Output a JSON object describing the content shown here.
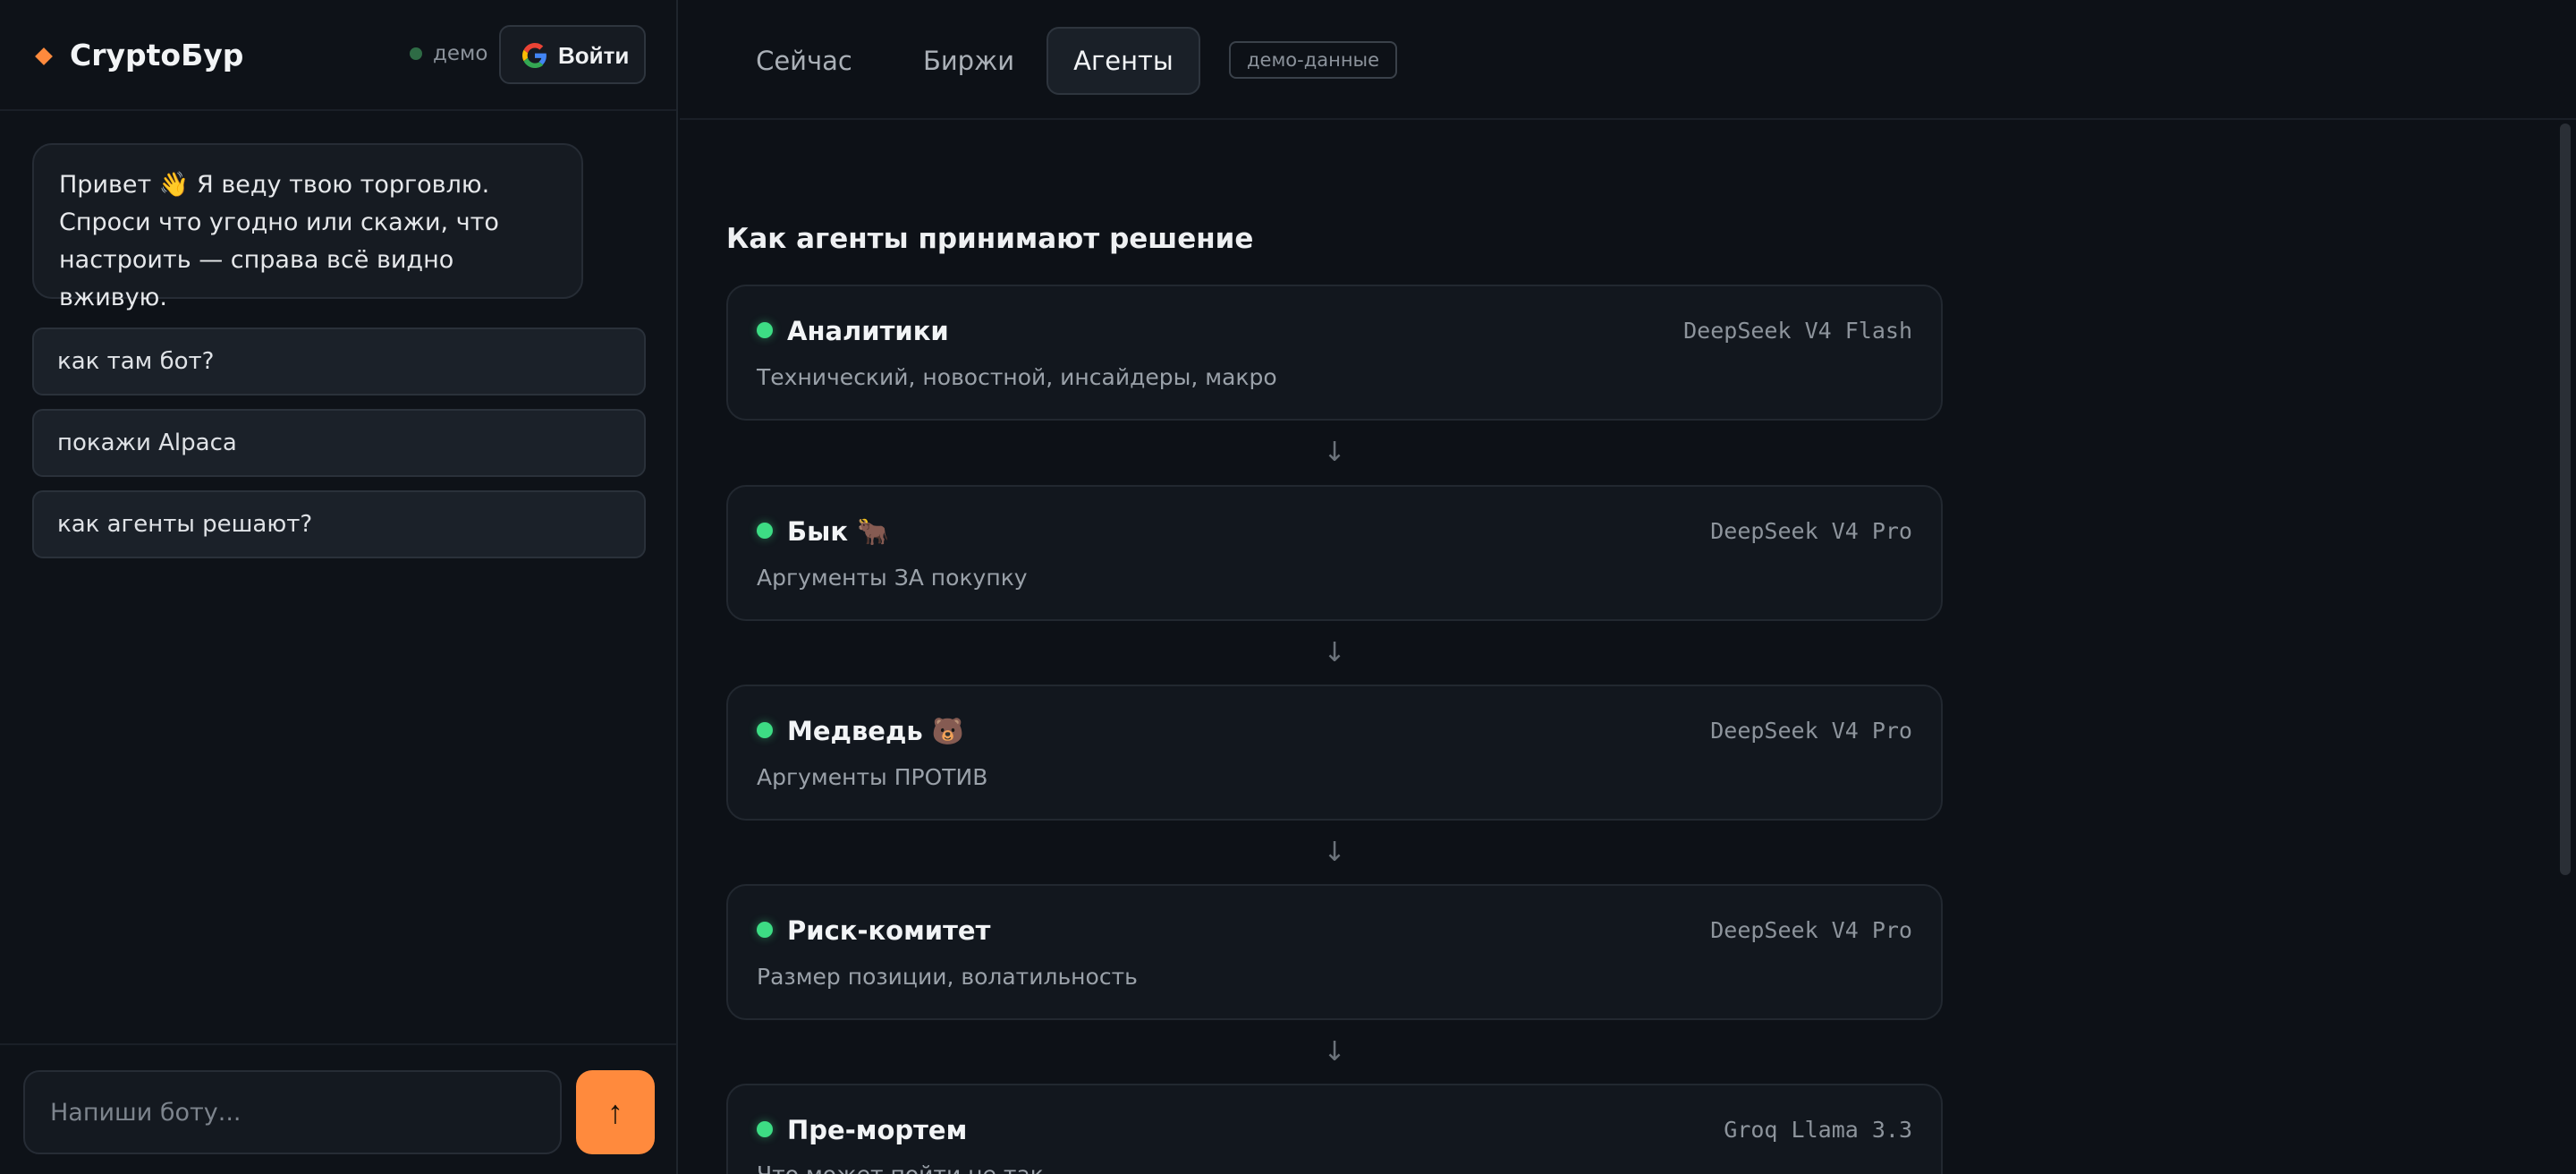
{
  "app": {
    "brand": "CryptoБур",
    "demo_label": "демо",
    "login_label": "Войти"
  },
  "chat": {
    "greeting": "Привет 👋 Я веду твою торговлю. Спроси что угодно или скажи, что настроить — справа всё видно вживую.",
    "suggestions": [
      "как там бот?",
      "покажи Alpaca",
      "как агенты решают?"
    ],
    "placeholder": "Напиши боту...",
    "send_icon": "↑"
  },
  "tabs": [
    {
      "label": "Сейчас",
      "active": false
    },
    {
      "label": "Биржи",
      "active": false
    },
    {
      "label": "Агенты",
      "active": true
    }
  ],
  "demo_badge": "демо-данные",
  "section_title": "Как агенты принимают решение",
  "flow_arrow": "↓",
  "agents": [
    {
      "title": "Аналитики",
      "model": "DeepSeek V4 Flash",
      "desc": "Технический, новостной, инсайдеры, макро"
    },
    {
      "title": "Бык 🐂",
      "model": "DeepSeek V4 Pro",
      "desc": "Аргументы ЗА покупку"
    },
    {
      "title": "Медведь 🐻",
      "model": "DeepSeek V4 Pro",
      "desc": "Аргументы ПРОТИВ"
    },
    {
      "title": "Риск-комитет",
      "model": "DeepSeek V4 Pro",
      "desc": "Размер позиции, волатильность"
    },
    {
      "title": "Пре-мортем",
      "model": "Groq Llama 3.3",
      "desc": "Что может пойти не так"
    }
  ],
  "colors": {
    "accent": "#ff8a3d",
    "status_active": "#3ddc84",
    "background": "#0d1117"
  },
  "icons": {
    "logo": "diamond-icon",
    "login": "google-icon",
    "send": "arrow-up-icon",
    "status": "status-dot-icon"
  }
}
